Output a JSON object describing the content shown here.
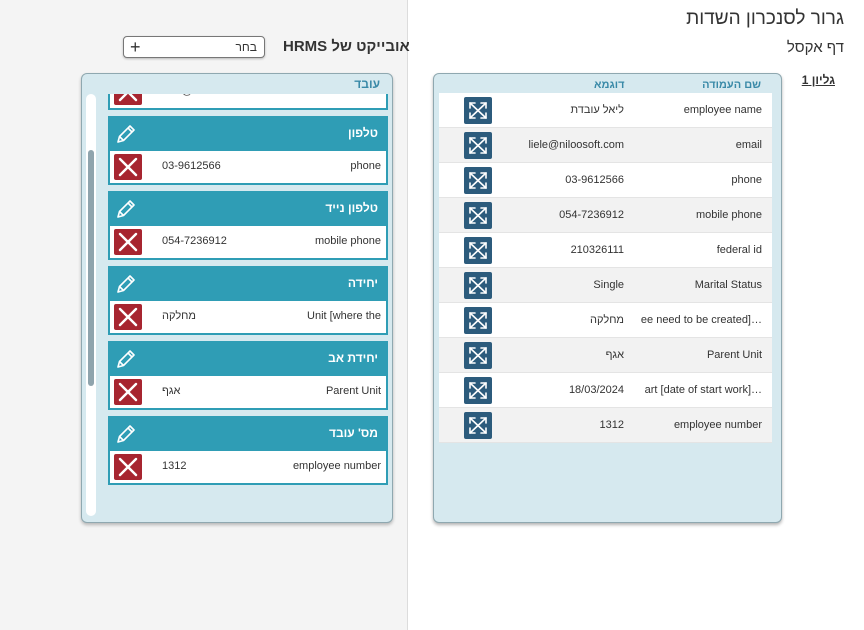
{
  "header": {
    "main_title": "גרור לסנכרון השדות",
    "sub_title": "דף אקסל",
    "sheet_link": "גליון 1"
  },
  "hrms": {
    "title": "אובייקט של HRMS",
    "select_label": "בחר",
    "panel_header": "עובד",
    "cards": [
      {
        "title": "",
        "value": "liele@niloosoft.com",
        "field": "email"
      },
      {
        "title": "טלפון",
        "value": "03-9612566",
        "field": "phone"
      },
      {
        "title": "טלפון נייד",
        "value": "054-7236912",
        "field": "mobile phone"
      },
      {
        "title": "יחידה",
        "value": "מחלקה",
        "field": "Unit [where the"
      },
      {
        "title": "יחידת אב",
        "value": "אגף",
        "field": "Parent Unit"
      },
      {
        "title": "מס' עובד",
        "value": "1312",
        "field": "employee number"
      }
    ]
  },
  "excel": {
    "col_name_header": "שם העמודה",
    "col_example_header": "דוגמא",
    "rows": [
      {
        "name": "employee name",
        "example": "ליאל עובדת"
      },
      {
        "name": "email",
        "example": "liele@niloosoft.com"
      },
      {
        "name": "phone",
        "example": "03-9612566"
      },
      {
        "name": "mobile phone",
        "example": "054-7236912"
      },
      {
        "name": "federal id",
        "example": "210326111"
      },
      {
        "name": "Marital Status",
        "example": "Single"
      },
      {
        "name": "ee need to be created]…",
        "example": "מחלקה"
      },
      {
        "name": "Parent Unit",
        "example": "אגף"
      },
      {
        "name": "art [date of start work]…",
        "example": "18/03/2024"
      },
      {
        "name": "employee number",
        "example": "1312"
      }
    ]
  },
  "colors": {
    "card_teal": "#2f9db5",
    "delete_red": "#a72530",
    "drag_navy": "#2c5b7c",
    "panel_bg": "#d6e9ef",
    "header_text": "#3a8aa8"
  },
  "icons": {
    "edit": "pencil-icon",
    "delete": "close-icon",
    "drag": "expand-arrows-icon",
    "add": "plus-icon"
  }
}
